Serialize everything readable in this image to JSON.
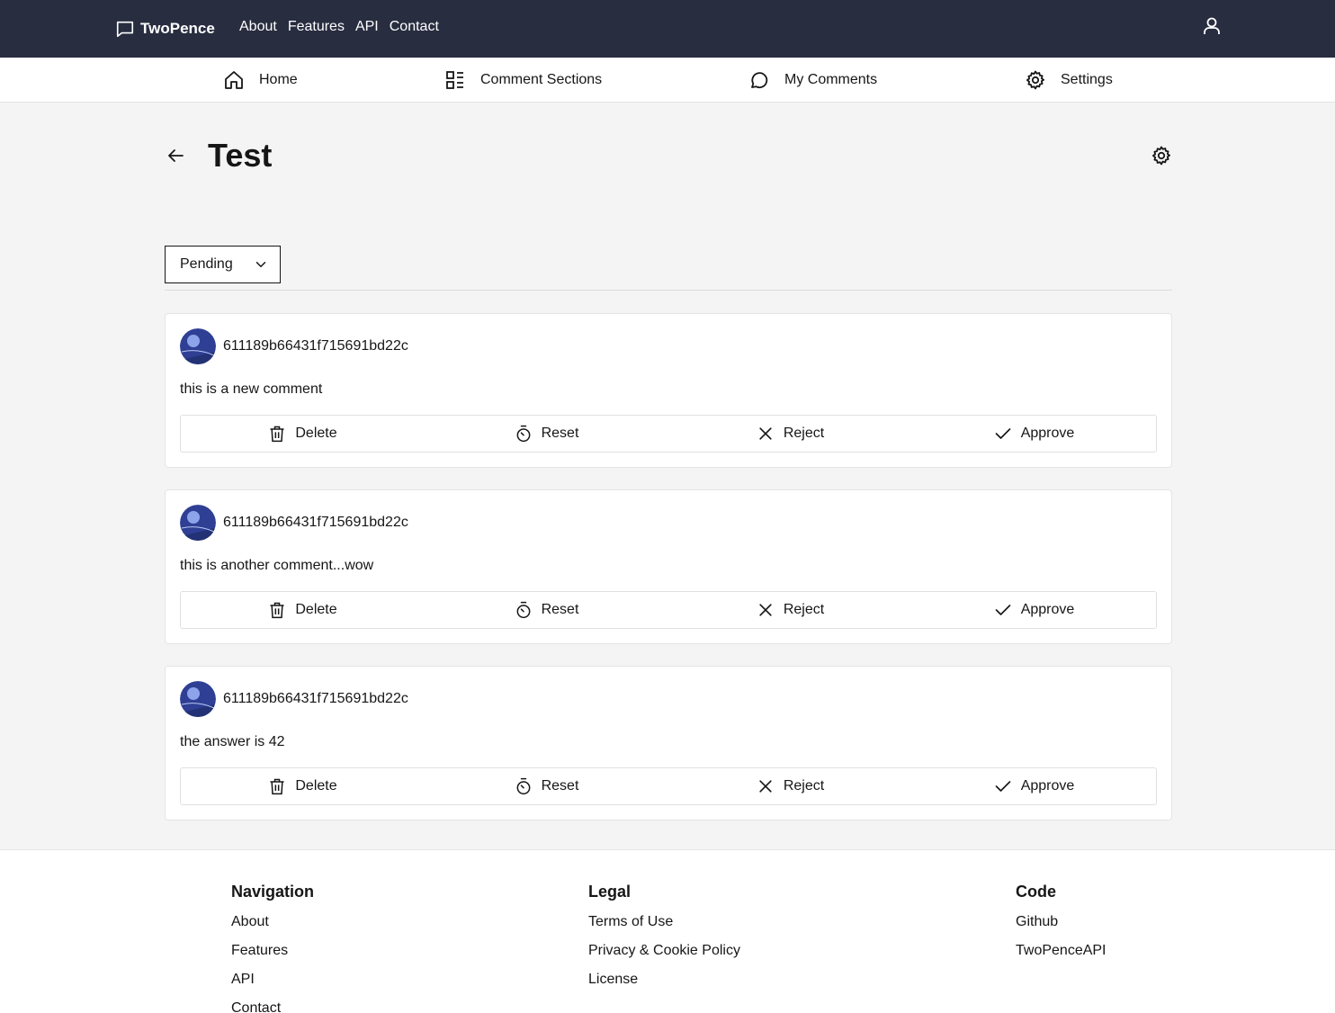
{
  "header": {
    "brand": "TwoPence",
    "nav": [
      "About",
      "Features",
      "API",
      "Contact"
    ]
  },
  "subnav": {
    "home": "Home",
    "sections": "Comment Sections",
    "my_comments": "My Comments",
    "settings": "Settings"
  },
  "page": {
    "title": "Test",
    "filter": "Pending"
  },
  "actions": {
    "delete": "Delete",
    "reset": "Reset",
    "reject": "Reject",
    "approve": "Approve"
  },
  "comments": [
    {
      "author": "611189b66431f715691bd22c",
      "text": "this is a new comment"
    },
    {
      "author": "611189b66431f715691bd22c",
      "text": "this is another comment...wow"
    },
    {
      "author": "611189b66431f715691bd22c",
      "text": "the answer is 42"
    }
  ],
  "footer": {
    "navigation": {
      "heading": "Navigation",
      "links": [
        "About",
        "Features",
        "API",
        "Contact"
      ]
    },
    "legal": {
      "heading": "Legal",
      "links": [
        "Terms of Use",
        "Privacy & Cookie Policy",
        "License"
      ]
    },
    "code": {
      "heading": "Code",
      "links": [
        "Github",
        "TwoPenceAPI"
      ]
    }
  },
  "colors": {
    "header_bg": "#282d40",
    "page_bg": "#f4f4f4",
    "avatar_blue": "#2e3f94"
  }
}
